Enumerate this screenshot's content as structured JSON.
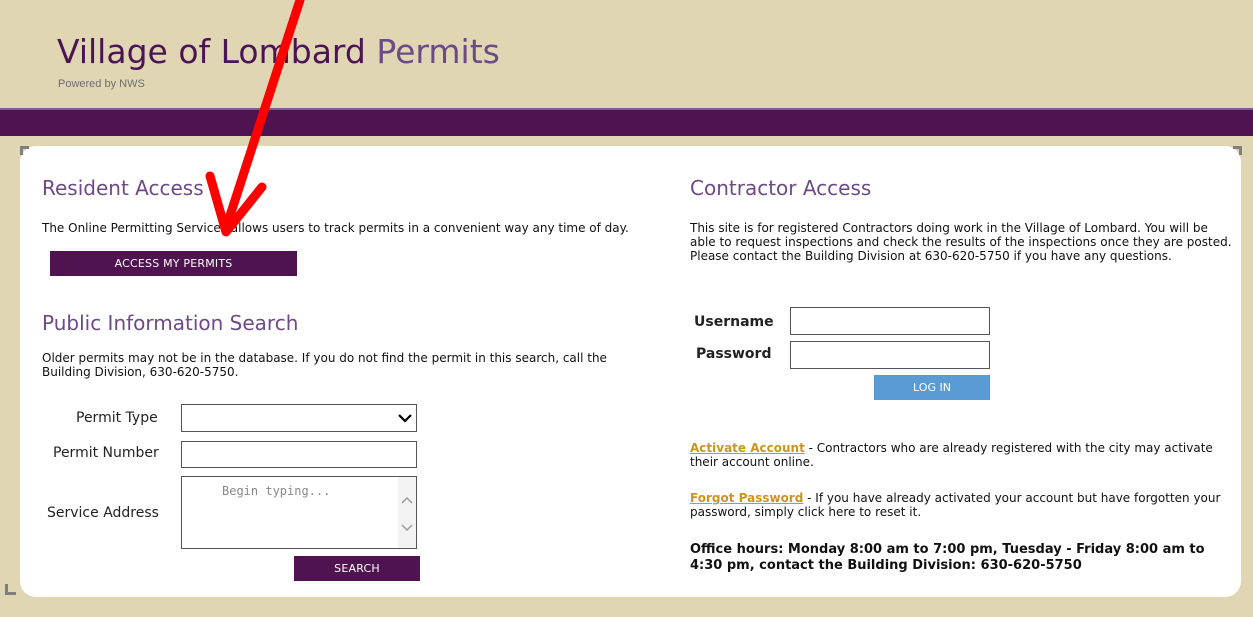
{
  "header": {
    "title_name": "Village of Lombard",
    "title_suffix": "Permits",
    "subtitle": "Powered by NWS"
  },
  "resident": {
    "heading": "Resident Access",
    "text": "The Online Permitting Services allows users to track permits in a convenient way any time of day.",
    "button": "ACCESS MY PERMITS"
  },
  "public_search": {
    "heading": "Public Information Search",
    "text": "Older permits may not be in the database. If you do not find the permit in this search, call the Building Division, 630-620-5750.",
    "permit_type_label": "Permit Type",
    "permit_type_value": "",
    "permit_number_label": "Permit Number",
    "permit_number_value": "",
    "service_address_label": "Service Address",
    "service_address_placeholder": "Begin typing...",
    "search_button": "SEARCH"
  },
  "contractor": {
    "heading": "Contractor Access",
    "text": "This site is for registered Contractors doing work in the Village of Lombard. You will be able to request inspections and check the results of the inspections once they are posted. Please contact the Building Division at 630-620-5750 if you have any questions.",
    "username_label": "Username",
    "username_value": "",
    "password_label": "Password",
    "password_value": "",
    "login_button": "LOG IN",
    "activate_link": "Activate Account",
    "activate_text": " - Contractors who are already registered with the city may activate their account online.",
    "forgot_link": "Forgot Password",
    "forgot_text": " - If you have already activated your account but have forgotten your password, simply click here to reset it.",
    "office_hours": "Office hours: Monday 8:00 am to 7:00 pm, Tuesday - Friday 8:00 am to 4:30 pm, contact the Building Division: 630-620-5750"
  },
  "colors": {
    "brand_purple": "#4f1450",
    "heading_purple": "#6d4a86",
    "login_blue": "#5a9bd5",
    "link_gold": "#c9971f",
    "annotation_red": "#ff0000"
  },
  "icons": {
    "select_arrow": "chevron-down-icon",
    "annotation": "red-arrow-icon"
  }
}
